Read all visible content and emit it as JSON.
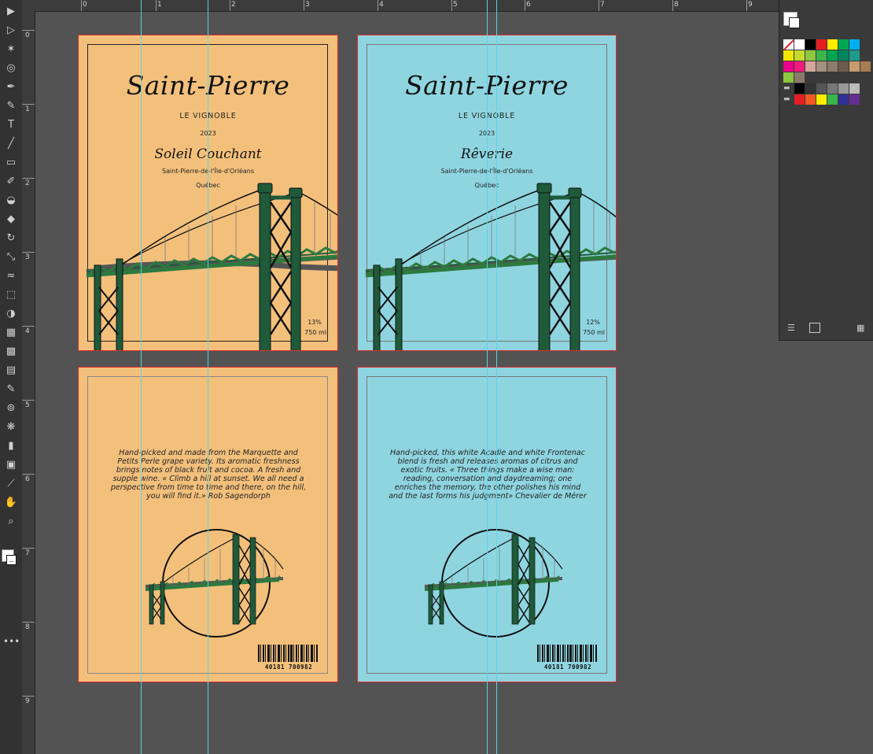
{
  "rulers": {
    "horizontal": [
      "0",
      "1",
      "2",
      "3",
      "4",
      "5",
      "6",
      "7",
      "8",
      "9"
    ],
    "vertical": [
      "0",
      "1",
      "2",
      "3",
      "4",
      "5",
      "6",
      "7",
      "8",
      "9"
    ]
  },
  "colors": {
    "orange_label": "#f3c07c",
    "blue_label": "#8fd5e0",
    "bridge_green": "#1f5a3a",
    "deck_green": "#2c7a3e",
    "road_gray": "#555555",
    "artboard_border": "#e02a2a",
    "guide": "#5ad7e6"
  },
  "fronts": [
    {
      "brand": "Saint-Pierre",
      "subtitle": "LE VIGNOBLE",
      "year": "2023",
      "wine_name": "Soleil Couchant",
      "location": "Saint-Pierre-de-l'Île-d'Orléans",
      "province": "Québec",
      "abv": "13%",
      "volume": "750 ml"
    },
    {
      "brand": "Saint-Pierre",
      "subtitle": "LE VIGNOBLE",
      "year": "2023",
      "wine_name": "Rêverie",
      "location": "Saint-Pierre-de-l'Île-d'Orléans",
      "province": "Québec",
      "abv": "12%",
      "volume": "750 ml"
    }
  ],
  "backs": [
    {
      "description": "Hand-picked and made from the Marquette and Petits Perle grape variety. Its aromatic freshness brings notes of black fruit and cocoa. A fresh and supple wine. « Climb a hill at sunset. We all need a perspective from time to time and there, on the hill, you will find it.» Rob Sagendorph",
      "barcode": "40181 700982"
    },
    {
      "description": "Hand-picked, this white Acadie and white Frontenac blend is fresh and releases aromas of citrus and exotic fruits. « Three things make a wise man: reading, conversation and daydreaming; one enriches the memory, the other polishes his mind and the last forms his judgment» Chevalier de Mérer",
      "barcode": "40181 700982"
    }
  ],
  "tools": [
    "selection-tool",
    "direct-selection-tool",
    "magic-wand-tool",
    "lasso-tool",
    "pen-tool",
    "curvature-tool",
    "type-tool",
    "line-tool",
    "rectangle-tool",
    "paintbrush-tool",
    "shaper-tool",
    "eraser-tool",
    "rotate-tool",
    "scale-tool",
    "width-tool",
    "free-transform-tool",
    "shape-builder-tool",
    "perspective-tool",
    "mesh-tool",
    "gradient-tool",
    "eyedropper-tool",
    "blend-tool",
    "symbol-sprayer-tool",
    "graph-tool",
    "artboard-tool",
    "slice-tool",
    "hand-tool",
    "zoom-tool"
  ],
  "swatches": {
    "row1": [
      "#ffffff",
      "#000000",
      "#e31e24",
      "#ffed00",
      "#00a651",
      "#00aeef"
    ],
    "row2": [
      "#f2e600",
      "#c6d92e",
      "#8dc63f",
      "#39b54a",
      "#00a651",
      "#00855f",
      "#1e9b8a"
    ],
    "row3": [
      "#ec008c",
      "#ed1c7a",
      "#d4a79a",
      "#a58f7e",
      "#8c7b6b",
      "#6b5b4e",
      "#c69c6d",
      "#a67c52"
    ],
    "row4": [
      "#8dc63f",
      "#8d7a6a"
    ],
    "row5": [
      "#000000",
      "#333333",
      "#555555",
      "#777777",
      "#999999",
      "#bbbbbb"
    ],
    "row6": [
      "#e31e24",
      "#f15a24",
      "#ffed00",
      "#39b54a",
      "#2e3192",
      "#662d91"
    ]
  }
}
